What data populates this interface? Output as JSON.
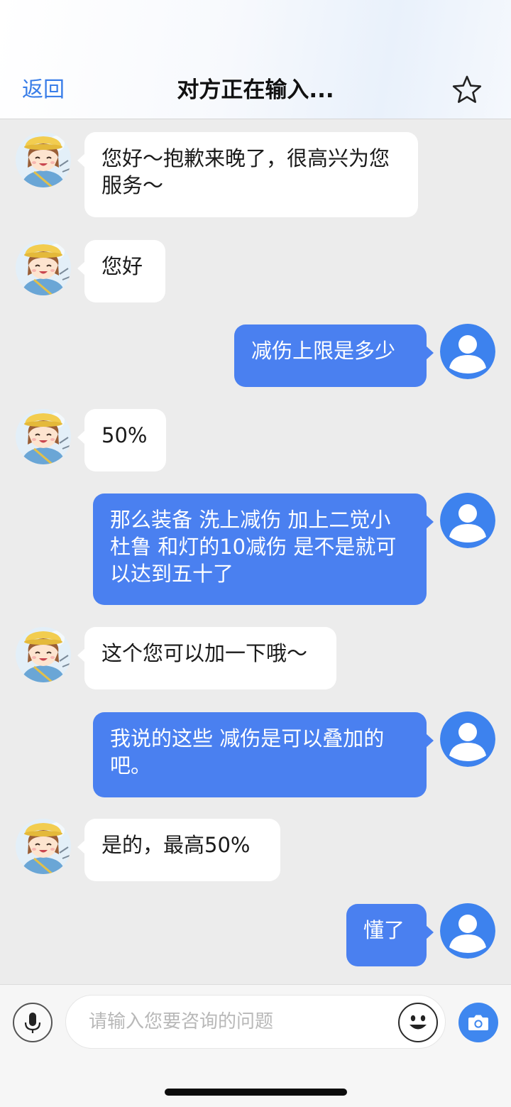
{
  "header": {
    "back_label": "返回",
    "title": "对方正在输入..."
  },
  "messages": [
    {
      "from": "agent",
      "text": "您好～抱歉来晚了，很高兴为您服务～"
    },
    {
      "from": "agent",
      "text": "您好"
    },
    {
      "from": "user",
      "text": "减伤上限是多少"
    },
    {
      "from": "agent",
      "text": "50%"
    },
    {
      "from": "user",
      "text": "那么装备 洗上减伤 加上二觉小杜鲁 和灯的10减伤 是不是就可以达到五十了"
    },
    {
      "from": "agent",
      "text": "这个您可以加一下哦～"
    },
    {
      "from": "user",
      "text": "我说的这些 减伤是可以叠加的吧。"
    },
    {
      "from": "agent",
      "text": "是的，最高50%"
    },
    {
      "from": "user",
      "text": "懂了"
    }
  ],
  "input": {
    "placeholder": "请输入您要咨询的问题"
  },
  "icons": {
    "star": "star-outline-icon",
    "agent_avatar": "agent-avatar",
    "user_avatar": "user-avatar-icon",
    "mic": "microphone-icon",
    "emoji": "smiley-face-icon",
    "camera": "camera-icon"
  },
  "colors": {
    "accent": "#3a7ee8",
    "user_bubble": "#4a80f0",
    "agent_bubble": "#ffffff",
    "background": "#ececec",
    "user_avatar": "#3d82ee",
    "camera_button": "#3f87ef"
  }
}
